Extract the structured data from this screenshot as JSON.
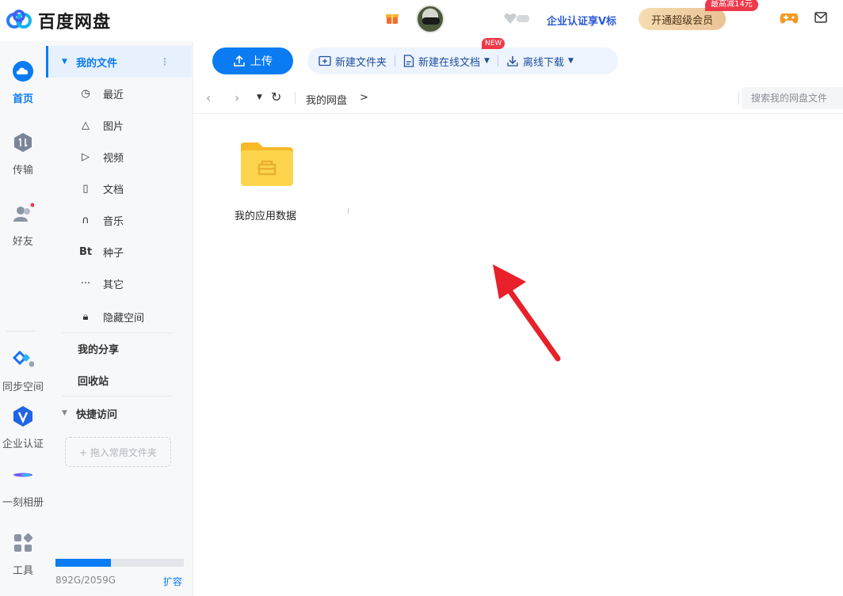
{
  "app": {
    "title": "百度网盘",
    "enterprise_link": "企业认证享V标",
    "vip_button": "开通超级会员",
    "promo_badge": "最高减14元"
  },
  "rail": {
    "items": [
      {
        "label": "首页",
        "active": true
      },
      {
        "label": "传输"
      },
      {
        "label": "好友"
      },
      {
        "label": "同步空间"
      },
      {
        "label": "企业认证"
      },
      {
        "label": "一刻相册"
      },
      {
        "label": "工具"
      }
    ]
  },
  "sidebar": {
    "my_files": "我的文件",
    "items": [
      {
        "label": "最近",
        "icon": "clock-icon"
      },
      {
        "label": "图片",
        "icon": "image-icon"
      },
      {
        "label": "视频",
        "icon": "play-icon"
      },
      {
        "label": "文档",
        "icon": "document-icon"
      },
      {
        "label": "音乐",
        "icon": "headphones-icon"
      },
      {
        "label": "种子",
        "icon": "bt-icon",
        "glyph": "Bt"
      },
      {
        "label": "其它",
        "icon": "more-icon"
      },
      {
        "label": "隐藏空间",
        "icon": "lock-icon"
      }
    ],
    "my_share": "我的分享",
    "recycle_bin": "回收站",
    "quick_access": "快捷访问",
    "drop_hint": "+ 拖入常用文件夹",
    "quota_text": "892G/2059G",
    "quota_used_fraction": 0.433,
    "expand_label": "扩容"
  },
  "toolbar": {
    "upload": "上传",
    "new_folder": "新建文件夹",
    "new_online_doc": "新建在线文档",
    "new_badge": "NEW",
    "offline_download": "离线下载"
  },
  "nav": {
    "breadcrumb": "我的网盘",
    "breadcrumb_sep": ">",
    "search_placeholder": "搜索我的网盘文件"
  },
  "files": [
    {
      "name": "我的应用数据",
      "type": "folder"
    }
  ],
  "colors": {
    "accent": "#0a7bf2",
    "folder": "#f9c640",
    "arrow": "#e8202a",
    "vip_gold": "#eac394"
  }
}
